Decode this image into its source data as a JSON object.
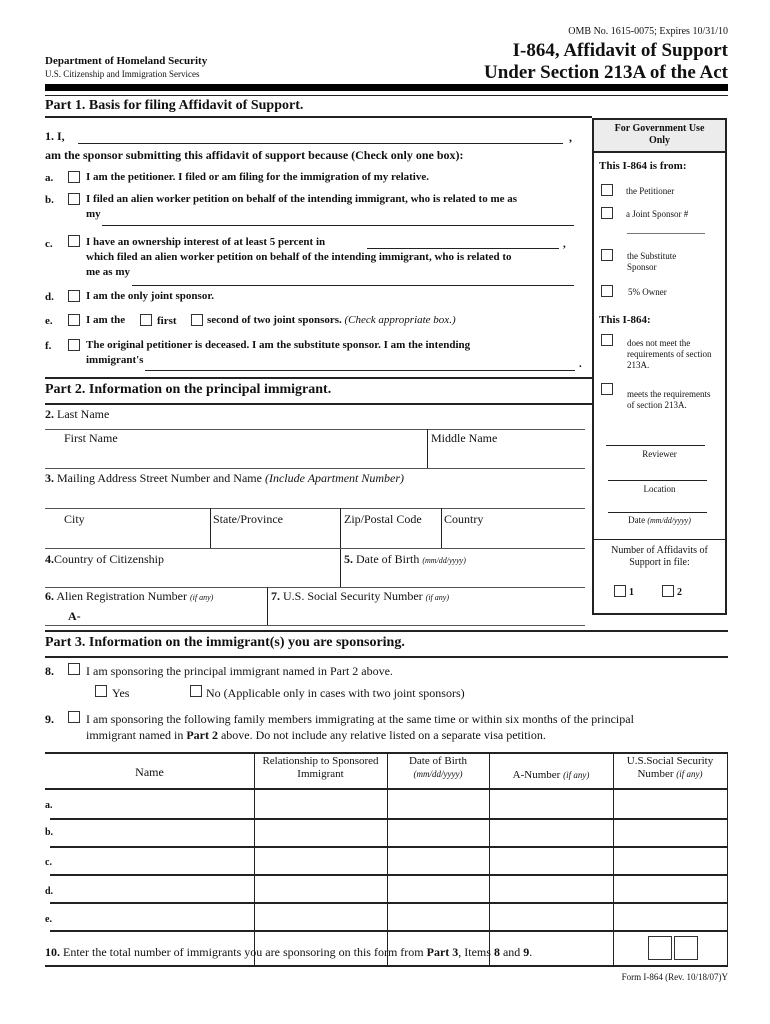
{
  "header": {
    "omb": "OMB No. 1615-0075; Expires 10/31/10",
    "title_line1": "I-864, Affidavit of Support",
    "title_line2": "Under Section 213A of the Act",
    "agency": "Department of Homeland Security",
    "sub_agency": "U.S. Citizenship and Immigration Services"
  },
  "part1": {
    "heading": "Part 1.   Basis for filing Affidavit of Support.",
    "item1_label": "1.  I,",
    "item1_comma": ",",
    "intro": "am the sponsor submitting this affidavit of support because (Check only one box):",
    "options": {
      "a": {
        "letter": "a.",
        "text": "I am the petitioner.  I filed or am filing for the immigration of my relative."
      },
      "b": {
        "letter": "b.",
        "text": "I filed an alien worker petition on behalf of the intending immigrant, who is related to me as",
        "text2": "my"
      },
      "c": {
        "letter": "c.",
        "text": "I have an ownership interest of at least 5 percent in",
        "comma": ",",
        "text2": "which filed an alien worker petition on behalf of the intending immigrant, who is related to",
        "text3": "me as my"
      },
      "d": {
        "letter": "d.",
        "text": "I am the only joint sponsor."
      },
      "e": {
        "letter": "e.",
        "text_pre": "I am the",
        "first": "first",
        "text_post": "second of two joint sponsors.",
        "note": "(Check appropriate box.)"
      },
      "f": {
        "letter": "f.",
        "text": "The original petitioner is deceased.  I am the substitute sponsor.  I am the intending",
        "text2": "immigrant's",
        "period": "."
      }
    }
  },
  "gov_box": {
    "title": "For Government Use Only",
    "from_heading": "This I-864 is from:",
    "from_options": [
      "the Petitioner",
      "a Joint Sponsor #",
      "the Substitute Sponsor",
      "5% Owner"
    ],
    "status_heading": "This I-864:",
    "status_options": [
      "does not meet the requirements of section 213A.",
      "meets the requirements of section 213A."
    ],
    "reviewer": "Reviewer",
    "location": "Location",
    "date_label": "Date",
    "date_format": "(mm/dd/yyyy)",
    "affidavits_label": "Number of Affidavits of Support in file:",
    "affidavit_counts": [
      "1",
      "2"
    ]
  },
  "part2": {
    "heading": "Part 2. Information on the principal immigrant.",
    "last_name_num": "2.",
    "last_name": "Last Name",
    "first_name": "First Name",
    "middle_name": "Middle Name",
    "address_num": "3.",
    "address": "Mailing Address  Street Number and Name",
    "address_note": "(Include Apartment Number)",
    "city": "City",
    "state": "State/Province",
    "zip": "Zip/Postal Code",
    "country": "Country",
    "citizenship_num": "4.",
    "citizenship": "Country of Citizenship",
    "dob_num": "5.",
    "dob": "Date of Birth",
    "dob_format": "(mm/dd/yyyy)",
    "alien_num": "6.",
    "alien": "Alien Registration Number",
    "alien_note": "(if any)",
    "alien_prefix": "A-",
    "ssn_num": "7.",
    "ssn": "U.S. Social Security Number",
    "ssn_note": "(if any)"
  },
  "part3": {
    "heading": "Part 3. Information on the immigrant(s) you are sponsoring.",
    "item8_num": "8.",
    "item8": "I am sponsoring the principal immigrant named in Part 2 above.",
    "yes": "Yes",
    "no": "No (Applicable only in cases with two joint sponsors)",
    "item9_num": "9.",
    "item9_line1": "I am sponsoring the following family members immigrating at the same time or within six months of the principal",
    "item9_line2_pre": "immigrant named in",
    "item9_line2_bold": "Part 2",
    "item9_line2_post": "above.  Do not include any relative listed on a separate visa petition.",
    "table": {
      "columns": [
        {
          "label": "Name",
          "note": ""
        },
        {
          "label": "Relationship to Sponsored Immigrant",
          "note": ""
        },
        {
          "label": "Date of Birth",
          "note": "(mm/dd/yyyy)"
        },
        {
          "label": "A-Number",
          "note": "(if any)"
        },
        {
          "label": "U.S.Social Security Number",
          "note": "(if any)"
        }
      ],
      "rows": [
        "a.",
        "b.",
        "c.",
        "d.",
        "e."
      ]
    },
    "item10_num": "10.",
    "item10_pre": "Enter the total number of immigrants you are sponsoring on this form from",
    "item10_part": "Part 3",
    "item10_mid": ", Items",
    "item10_8": "8",
    "item10_and": "and",
    "item10_9": "9",
    "item10_end": "."
  },
  "footer": {
    "form_id": "Form I-864 (Rev. 10/18/07)Y"
  }
}
